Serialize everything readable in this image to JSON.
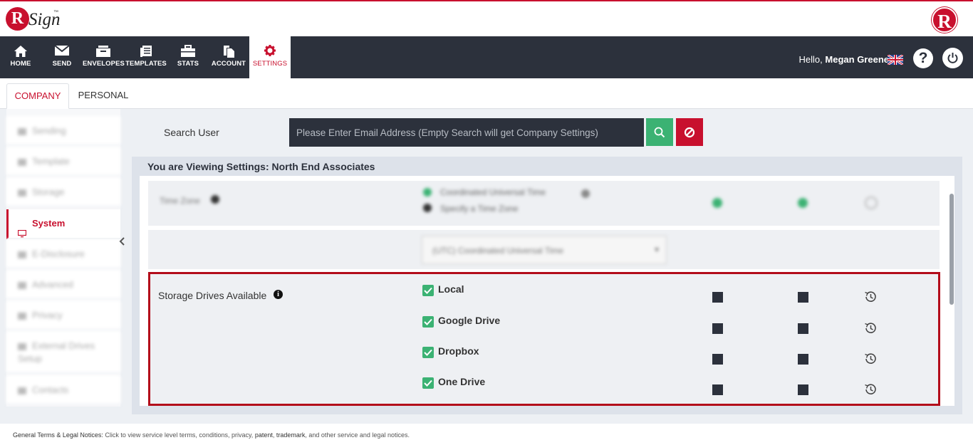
{
  "brand": {
    "logo_letter": "R",
    "logo_text": "Sign",
    "logo_tm": "™",
    "corner_letter": "R",
    "accent_color": "#c8102e"
  },
  "nav": {
    "items": [
      {
        "label": "HOME",
        "icon": "home-icon"
      },
      {
        "label": "SEND",
        "icon": "envelope-icon"
      },
      {
        "label": "ENVELOPES",
        "icon": "inbox-icon"
      },
      {
        "label": "TEMPLATES",
        "icon": "document-icon"
      },
      {
        "label": "STATS",
        "icon": "briefcase-icon"
      },
      {
        "label": "ACCOUNT",
        "icon": "copy-icon"
      },
      {
        "label": "SETTINGS",
        "icon": "gear-icon",
        "active": true
      }
    ],
    "hello_prefix": "Hello,",
    "user_name": "Megan Greene",
    "flag_icon": "uk-flag-icon",
    "help_label": "?"
  },
  "tabs": [
    {
      "label": "COMPANY",
      "active": true
    },
    {
      "label": "PERSONAL",
      "active": false
    }
  ],
  "sidebar": {
    "items": [
      {
        "label": "Sending",
        "blurred": true
      },
      {
        "label": "Template",
        "blurred": true
      },
      {
        "label": "Storage",
        "blurred": true
      },
      {
        "label": "System",
        "active": true,
        "icon": "monitor-icon"
      },
      {
        "label": "E-Disclosure",
        "blurred": true
      },
      {
        "label": "Advanced",
        "blurred": true
      },
      {
        "label": "Privacy",
        "blurred": true
      },
      {
        "label": "External Drives Setup",
        "blurred": true
      },
      {
        "label": "Contacts",
        "blurred": true
      }
    ]
  },
  "search": {
    "label": "Search User",
    "placeholder": "Please Enter Email Address (Empty Search will get Company Settings)"
  },
  "viewing": {
    "text": "You are Viewing Settings: North End Associates"
  },
  "blurred_rows": {
    "timezone_label": "Time Zone",
    "option_1": "Coordinated Universal Time",
    "option_2": "Specify a Time Zone",
    "select_value": "(UTC) Coordinated Universal Time"
  },
  "storage": {
    "label": "Storage Drives Available",
    "info_glyph": "i",
    "drives": [
      {
        "name": "Local",
        "checked": true
      },
      {
        "name": "Google Drive",
        "checked": true
      },
      {
        "name": "Dropbox",
        "checked": true
      },
      {
        "name": "One Drive",
        "checked": true
      }
    ]
  },
  "footer": {
    "title": "General Terms & Legal Notices:",
    "text_1": " Click to view service level terms, conditions, privacy, ",
    "patent": "patent",
    "comma": ", ",
    "trademark": "trademark",
    "text_2": ", and other service and legal notices."
  }
}
